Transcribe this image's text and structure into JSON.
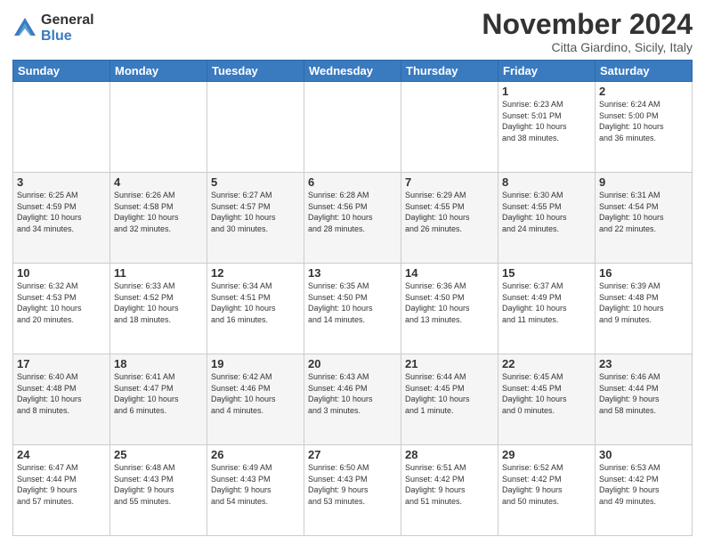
{
  "logo": {
    "general": "General",
    "blue": "Blue"
  },
  "header": {
    "title": "November 2024",
    "subtitle": "Citta Giardino, Sicily, Italy"
  },
  "weekdays": [
    "Sunday",
    "Monday",
    "Tuesday",
    "Wednesday",
    "Thursday",
    "Friday",
    "Saturday"
  ],
  "weeks": [
    [
      {
        "day": "",
        "info": ""
      },
      {
        "day": "",
        "info": ""
      },
      {
        "day": "",
        "info": ""
      },
      {
        "day": "",
        "info": ""
      },
      {
        "day": "",
        "info": ""
      },
      {
        "day": "1",
        "info": "Sunrise: 6:23 AM\nSunset: 5:01 PM\nDaylight: 10 hours\nand 38 minutes."
      },
      {
        "day": "2",
        "info": "Sunrise: 6:24 AM\nSunset: 5:00 PM\nDaylight: 10 hours\nand 36 minutes."
      }
    ],
    [
      {
        "day": "3",
        "info": "Sunrise: 6:25 AM\nSunset: 4:59 PM\nDaylight: 10 hours\nand 34 minutes."
      },
      {
        "day": "4",
        "info": "Sunrise: 6:26 AM\nSunset: 4:58 PM\nDaylight: 10 hours\nand 32 minutes."
      },
      {
        "day": "5",
        "info": "Sunrise: 6:27 AM\nSunset: 4:57 PM\nDaylight: 10 hours\nand 30 minutes."
      },
      {
        "day": "6",
        "info": "Sunrise: 6:28 AM\nSunset: 4:56 PM\nDaylight: 10 hours\nand 28 minutes."
      },
      {
        "day": "7",
        "info": "Sunrise: 6:29 AM\nSunset: 4:55 PM\nDaylight: 10 hours\nand 26 minutes."
      },
      {
        "day": "8",
        "info": "Sunrise: 6:30 AM\nSunset: 4:55 PM\nDaylight: 10 hours\nand 24 minutes."
      },
      {
        "day": "9",
        "info": "Sunrise: 6:31 AM\nSunset: 4:54 PM\nDaylight: 10 hours\nand 22 minutes."
      }
    ],
    [
      {
        "day": "10",
        "info": "Sunrise: 6:32 AM\nSunset: 4:53 PM\nDaylight: 10 hours\nand 20 minutes."
      },
      {
        "day": "11",
        "info": "Sunrise: 6:33 AM\nSunset: 4:52 PM\nDaylight: 10 hours\nand 18 minutes."
      },
      {
        "day": "12",
        "info": "Sunrise: 6:34 AM\nSunset: 4:51 PM\nDaylight: 10 hours\nand 16 minutes."
      },
      {
        "day": "13",
        "info": "Sunrise: 6:35 AM\nSunset: 4:50 PM\nDaylight: 10 hours\nand 14 minutes."
      },
      {
        "day": "14",
        "info": "Sunrise: 6:36 AM\nSunset: 4:50 PM\nDaylight: 10 hours\nand 13 minutes."
      },
      {
        "day": "15",
        "info": "Sunrise: 6:37 AM\nSunset: 4:49 PM\nDaylight: 10 hours\nand 11 minutes."
      },
      {
        "day": "16",
        "info": "Sunrise: 6:39 AM\nSunset: 4:48 PM\nDaylight: 10 hours\nand 9 minutes."
      }
    ],
    [
      {
        "day": "17",
        "info": "Sunrise: 6:40 AM\nSunset: 4:48 PM\nDaylight: 10 hours\nand 8 minutes."
      },
      {
        "day": "18",
        "info": "Sunrise: 6:41 AM\nSunset: 4:47 PM\nDaylight: 10 hours\nand 6 minutes."
      },
      {
        "day": "19",
        "info": "Sunrise: 6:42 AM\nSunset: 4:46 PM\nDaylight: 10 hours\nand 4 minutes."
      },
      {
        "day": "20",
        "info": "Sunrise: 6:43 AM\nSunset: 4:46 PM\nDaylight: 10 hours\nand 3 minutes."
      },
      {
        "day": "21",
        "info": "Sunrise: 6:44 AM\nSunset: 4:45 PM\nDaylight: 10 hours\nand 1 minute."
      },
      {
        "day": "22",
        "info": "Sunrise: 6:45 AM\nSunset: 4:45 PM\nDaylight: 10 hours\nand 0 minutes."
      },
      {
        "day": "23",
        "info": "Sunrise: 6:46 AM\nSunset: 4:44 PM\nDaylight: 9 hours\nand 58 minutes."
      }
    ],
    [
      {
        "day": "24",
        "info": "Sunrise: 6:47 AM\nSunset: 4:44 PM\nDaylight: 9 hours\nand 57 minutes."
      },
      {
        "day": "25",
        "info": "Sunrise: 6:48 AM\nSunset: 4:43 PM\nDaylight: 9 hours\nand 55 minutes."
      },
      {
        "day": "26",
        "info": "Sunrise: 6:49 AM\nSunset: 4:43 PM\nDaylight: 9 hours\nand 54 minutes."
      },
      {
        "day": "27",
        "info": "Sunrise: 6:50 AM\nSunset: 4:43 PM\nDaylight: 9 hours\nand 53 minutes."
      },
      {
        "day": "28",
        "info": "Sunrise: 6:51 AM\nSunset: 4:42 PM\nDaylight: 9 hours\nand 51 minutes."
      },
      {
        "day": "29",
        "info": "Sunrise: 6:52 AM\nSunset: 4:42 PM\nDaylight: 9 hours\nand 50 minutes."
      },
      {
        "day": "30",
        "info": "Sunrise: 6:53 AM\nSunset: 4:42 PM\nDaylight: 9 hours\nand 49 minutes."
      }
    ]
  ]
}
